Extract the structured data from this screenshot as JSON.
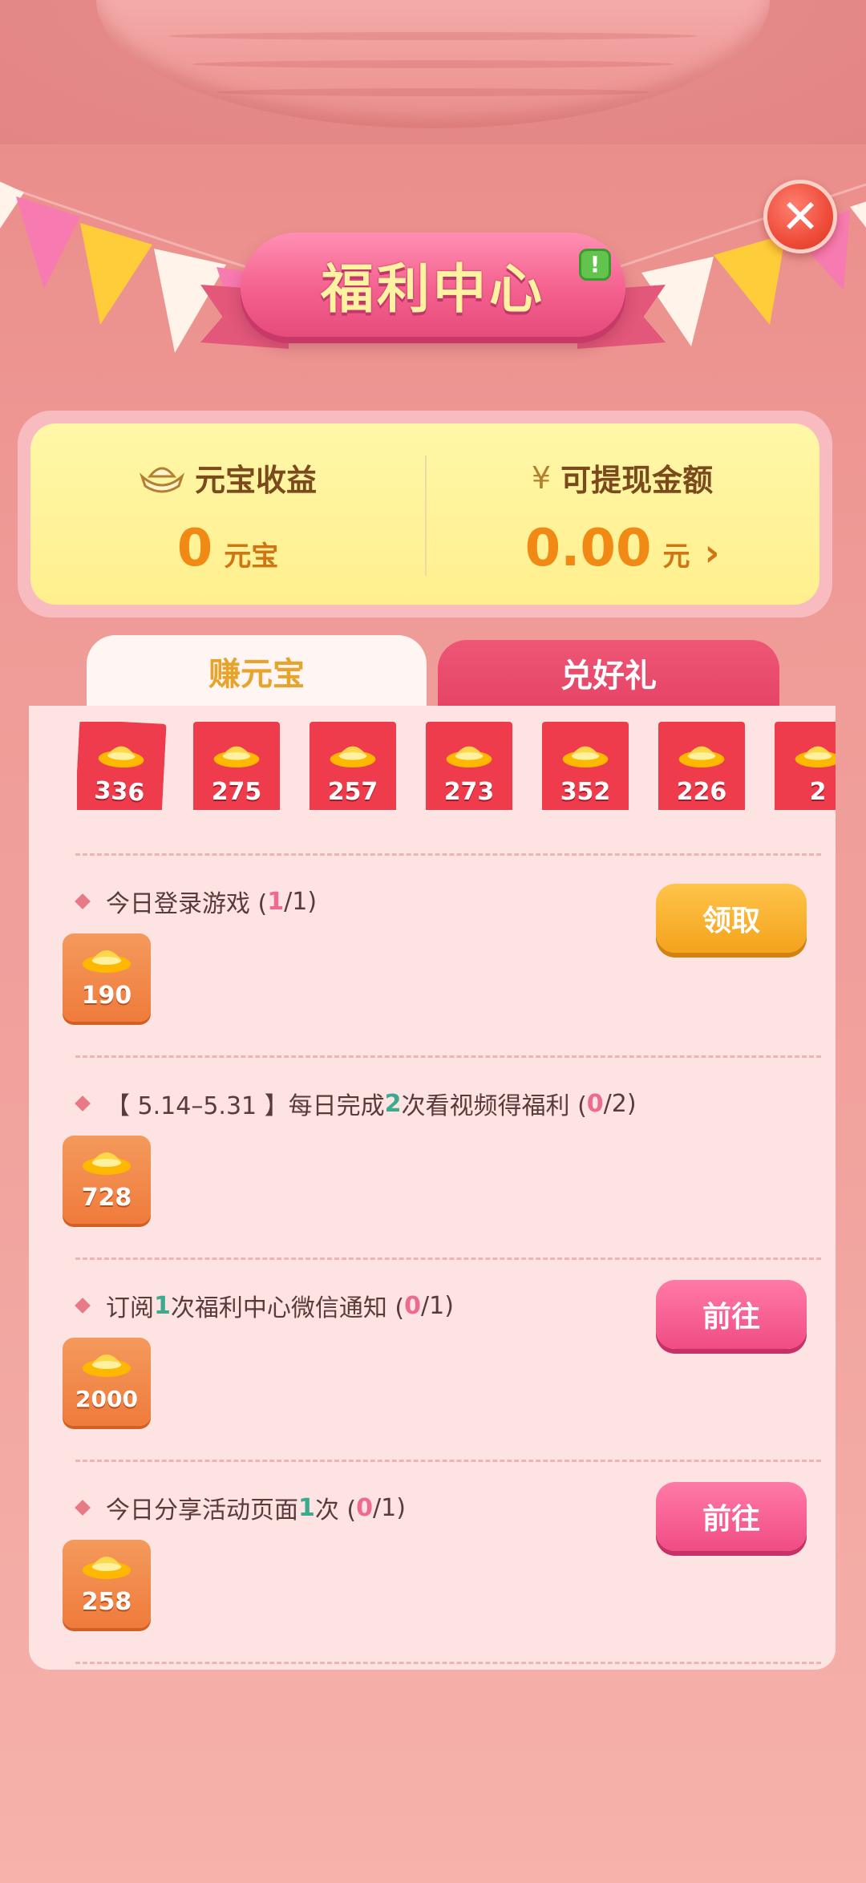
{
  "header": {
    "title": "福利中心",
    "alert_badge": "!",
    "close_icon": "✕"
  },
  "stats": {
    "ingot": {
      "icon": "ingot-icon",
      "label": "元宝收益",
      "value": "0",
      "unit": "元宝"
    },
    "cash": {
      "icon": "yen-icon",
      "icon_glyph": "¥",
      "label": "可提现金额",
      "value": "0.00",
      "unit": "元",
      "arrow": "›"
    }
  },
  "tabs": [
    {
      "label": "赚元宝",
      "active": true
    },
    {
      "label": "兑好礼",
      "active": false
    }
  ],
  "envelopes": [
    "336",
    "275",
    "257",
    "273",
    "352",
    "226",
    "2"
  ],
  "tasks": [
    {
      "title_parts": {
        "text": "今日登录游戏 (",
        "progress_done": "1",
        "progress_rest": "/1)"
      },
      "reward": "190",
      "button": "领取"
    },
    {
      "title_parts": {
        "pre": "【 5.14–5.31 】每日完成",
        "highlight": "2",
        "mid": "次看视频得福利 (",
        "progress_done": "0",
        "progress_rest": "/2)"
      },
      "reward": "728",
      "button": ""
    },
    {
      "title_parts": {
        "pre": "订阅",
        "highlight": "1",
        "mid": "次福利中心微信通知 (",
        "progress_done": "0",
        "progress_rest": "/1)"
      },
      "reward": "2000",
      "button": "前往"
    },
    {
      "title_parts": {
        "pre": "今日分享活动页面",
        "highlight": "1",
        "mid": "次 (",
        "progress_done": "0",
        "progress_rest": "/1)"
      },
      "reward": "258",
      "button": "前往"
    }
  ],
  "colors": {
    "accent_orange": "#f08a14",
    "button_gold": "#f4a31c",
    "button_pink": "#f04c83",
    "envelope_red": "#ef3c4c",
    "highlight_green": "#3daa8e"
  }
}
